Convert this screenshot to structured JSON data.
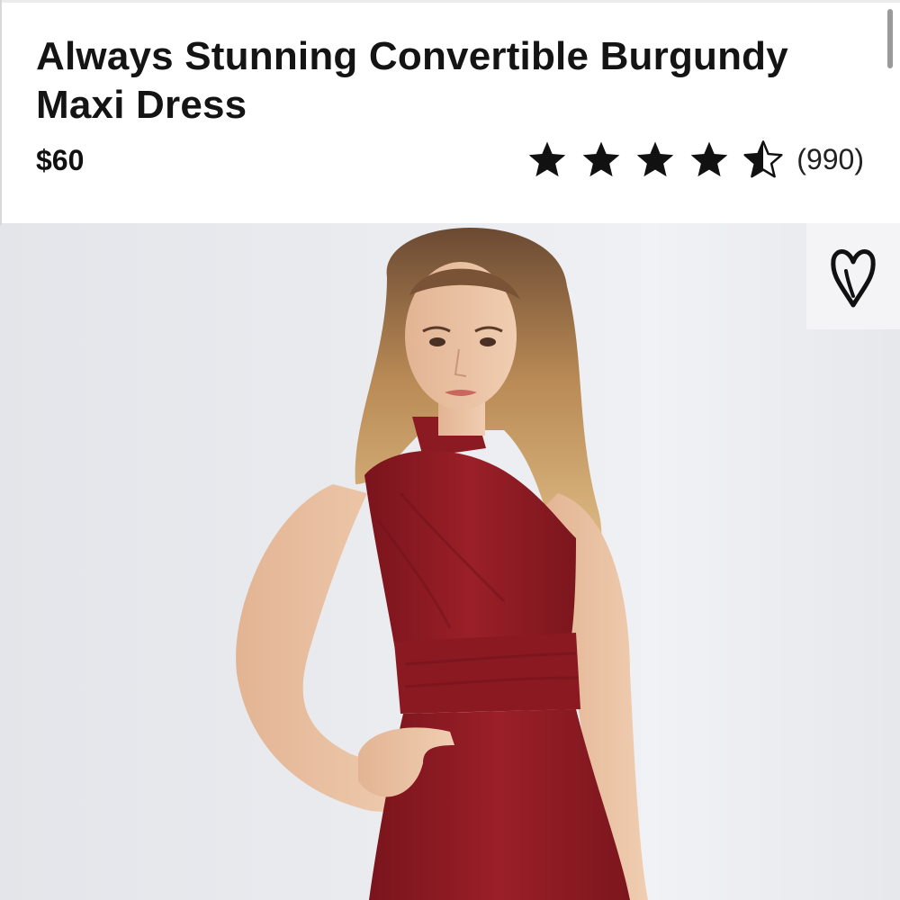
{
  "product": {
    "title": "Always Stunning Convertible Burgundy Maxi Dress",
    "price": "$60",
    "rating": {
      "value": 4.5,
      "out_of": 5,
      "count_label": "(990)"
    }
  },
  "icons": {
    "star": "star-icon",
    "half_star": "half-star-icon",
    "wishlist": "heart-icon"
  },
  "colors": {
    "dress": "#8e1a22",
    "background": "#ffffff",
    "text": "#111111"
  }
}
